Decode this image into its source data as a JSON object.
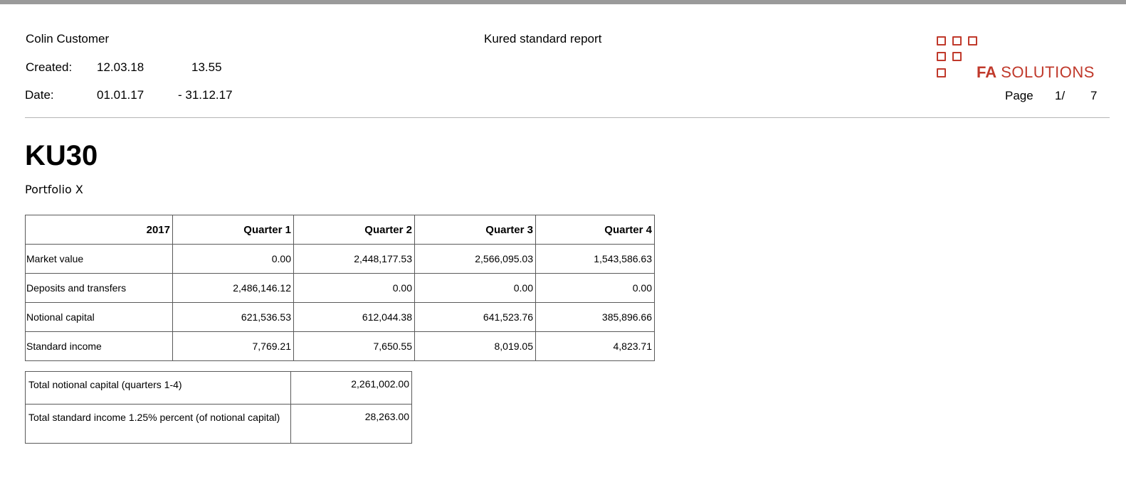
{
  "header": {
    "customer_name": "Colin Customer",
    "report_title": "Kured standard report",
    "created_label": "Created:",
    "created_date": "12.03.18",
    "created_time": "13.55",
    "date_label": "Date:",
    "date_from": "01.01.17",
    "date_to": "- 31.12.17",
    "page_label": "Page",
    "page_current": "1/",
    "page_total": "7"
  },
  "logo": {
    "brand_bold": "FA",
    "brand_rest": "SOLUTIONS",
    "color": "#c0392b"
  },
  "report": {
    "code": "KU30",
    "portfolio": "Portfolio X"
  },
  "main_table": {
    "headers": [
      "2017",
      "Quarter 1",
      "Quarter 2",
      "Quarter 3",
      "Quarter 4"
    ],
    "rows": [
      {
        "label": "Market value",
        "values": [
          "0.00",
          "2,448,177.53",
          "2,566,095.03",
          "1,543,586.63"
        ]
      },
      {
        "label": "Deposits and transfers",
        "values": [
          "2,486,146.12",
          "0.00",
          "0.00",
          "0.00"
        ]
      },
      {
        "label": "Notional capital",
        "values": [
          "621,536.53",
          "612,044.38",
          "641,523.76",
          "385,896.66"
        ]
      },
      {
        "label": "Standard income",
        "values": [
          "7,769.21",
          "7,650.55",
          "8,019.05",
          "4,823.71"
        ]
      }
    ]
  },
  "totals": [
    {
      "label": "Total notional capital (quarters 1-4)",
      "value": "2,261,002.00"
    },
    {
      "label": "Total standard income 1.25% percent (of notional capital)",
      "value": "28,263.00"
    }
  ]
}
